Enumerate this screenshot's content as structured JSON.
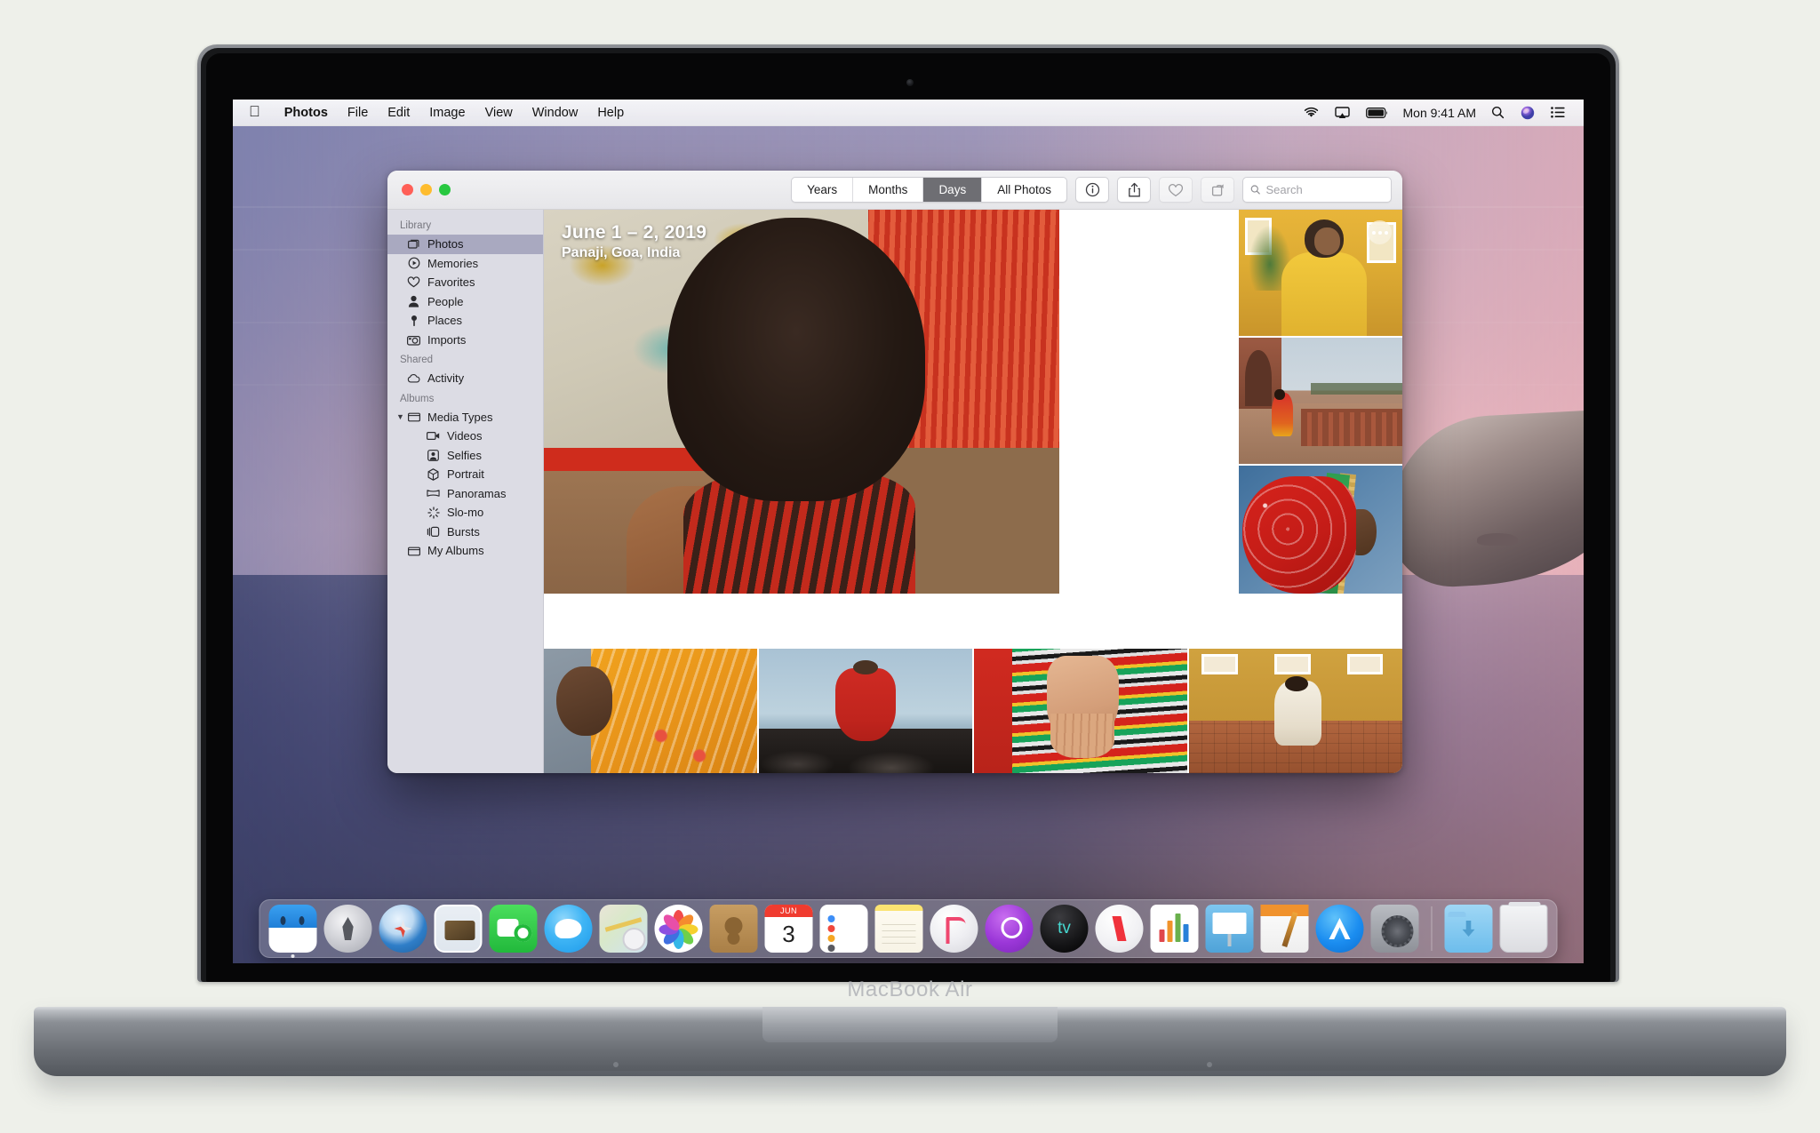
{
  "device": {
    "model_label": "MacBook Air"
  },
  "menubar": {
    "apple_glyph": "",
    "app_name": "Photos",
    "items": [
      "File",
      "Edit",
      "Image",
      "View",
      "Window",
      "Help"
    ],
    "status": {
      "wifi_icon": "wifi-icon",
      "airplay_icon": "airplay-icon",
      "battery_icon": "battery-icon",
      "clock": "Mon 9:41 AM",
      "spotlight_icon": "search-icon",
      "siri_icon": "siri-icon",
      "control_center_icon": "control-center-icon"
    }
  },
  "window": {
    "traffic_lights": {
      "close": "close",
      "minimize": "minimize",
      "zoom": "zoom"
    },
    "toolbar": {
      "segments": [
        {
          "label": "Years",
          "active": false
        },
        {
          "label": "Months",
          "active": false
        },
        {
          "label": "Days",
          "active": true
        },
        {
          "label": "All Photos",
          "active": false
        }
      ],
      "buttons": [
        {
          "name": "info-button",
          "icon": "info-icon",
          "enabled": true
        },
        {
          "name": "share-button",
          "icon": "share-icon",
          "enabled": true
        },
        {
          "name": "favorite-button",
          "icon": "heart-icon",
          "enabled": false
        },
        {
          "name": "rotate-button",
          "icon": "rotate-icon",
          "enabled": false
        }
      ],
      "search": {
        "placeholder": "Search",
        "value": "",
        "icon": "search-icon"
      }
    },
    "sidebar": {
      "sections": [
        {
          "title": "Library",
          "items": [
            {
              "label": "Photos",
              "icon": "photos-icon",
              "selected": true,
              "level": 0
            },
            {
              "label": "Memories",
              "icon": "memories-icon",
              "selected": false,
              "level": 0
            },
            {
              "label": "Favorites",
              "icon": "heart-icon",
              "selected": false,
              "level": 0
            },
            {
              "label": "People",
              "icon": "person-icon",
              "selected": false,
              "level": 0
            },
            {
              "label": "Places",
              "icon": "pin-icon",
              "selected": false,
              "level": 0
            },
            {
              "label": "Imports",
              "icon": "camera-icon",
              "selected": false,
              "level": 0
            }
          ]
        },
        {
          "title": "Shared",
          "items": [
            {
              "label": "Activity",
              "icon": "cloud-icon",
              "selected": false,
              "level": 0
            }
          ]
        },
        {
          "title": "Albums",
          "items": [
            {
              "label": "Media Types",
              "icon": "folder-icon",
              "selected": false,
              "level": 0,
              "expanded": true,
              "disclosure": "▼"
            },
            {
              "label": "Videos",
              "icon": "video-icon",
              "selected": false,
              "level": 1
            },
            {
              "label": "Selfies",
              "icon": "selfie-icon",
              "selected": false,
              "level": 1
            },
            {
              "label": "Portrait",
              "icon": "cube-icon",
              "selected": false,
              "level": 1
            },
            {
              "label": "Panoramas",
              "icon": "panorama-icon",
              "selected": false,
              "level": 1
            },
            {
              "label": "Slo-mo",
              "icon": "slomo-icon",
              "selected": false,
              "level": 1
            },
            {
              "label": "Bursts",
              "icon": "bursts-icon",
              "selected": false,
              "level": 1
            },
            {
              "label": "My Albums",
              "icon": "folder-icon",
              "selected": false,
              "level": 0
            }
          ]
        }
      ]
    },
    "grid": {
      "hero": {
        "date_range": "June 1 – 2, 2019",
        "location": "Panaji, Goa, India",
        "alt": "portrait of a woman with curly hair against a red shutter"
      },
      "more_button": {
        "name": "more-options-button",
        "icon": "ellipsis-icon"
      },
      "right_column": [
        {
          "alt": "man in yellow kurta by a yellow building"
        },
        {
          "alt": "woman in red sari walking at a monument"
        },
        {
          "alt": "woman in red bandhani veil against a blue wall"
        }
      ],
      "bottom_row": [
        {
          "alt": "woman in orange floral sari"
        },
        {
          "alt": "child in red dress on coastal rocks"
        },
        {
          "alt": "hand resting on striped cloth"
        },
        {
          "alt": "woman in white sari by an ochre wall"
        }
      ]
    }
  },
  "dock": {
    "items": [
      {
        "label": "Finder",
        "class": "i-finder",
        "running": true
      },
      {
        "label": "Launchpad",
        "class": "i-launchpad",
        "running": false
      },
      {
        "label": "Safari",
        "class": "i-safari",
        "running": false
      },
      {
        "label": "Mail",
        "class": "i-mail",
        "running": false
      },
      {
        "label": "FaceTime",
        "class": "i-facetime",
        "running": false
      },
      {
        "label": "Messages",
        "class": "i-messages",
        "running": false
      },
      {
        "label": "Maps",
        "class": "i-maps",
        "running": false
      },
      {
        "label": "Photos",
        "class": "i-photos",
        "running": true
      },
      {
        "label": "Contacts",
        "class": "i-contacts",
        "running": false
      },
      {
        "label": "Calendar",
        "class": "i-calendar",
        "running": false,
        "cal_month": "JUN",
        "cal_day": "3"
      },
      {
        "label": "Reminders",
        "class": "i-reminders",
        "running": false
      },
      {
        "label": "Notes",
        "class": "i-notes",
        "running": false
      },
      {
        "label": "iTunes",
        "class": "i-itunes",
        "running": false
      },
      {
        "label": "Podcasts",
        "class": "i-podcasts",
        "running": false
      },
      {
        "label": "Apple TV",
        "class": "i-appletv",
        "running": false,
        "glyph": "tv"
      },
      {
        "label": "News",
        "class": "i-news",
        "running": false
      },
      {
        "label": "Numbers",
        "class": "i-numbers",
        "running": false
      },
      {
        "label": "Keynote",
        "class": "i-keynote",
        "running": false
      },
      {
        "label": "Pages",
        "class": "i-pages",
        "running": false
      },
      {
        "label": "App Store",
        "class": "i-appstore",
        "running": false
      },
      {
        "label": "System Preferences",
        "class": "i-syspref",
        "running": false
      }
    ],
    "trailing": [
      {
        "label": "Downloads",
        "class": "i-downloads"
      },
      {
        "label": "Trash",
        "class": "i-trash"
      }
    ]
  },
  "colors": {
    "selection": "#a9a9c0",
    "segment_active_bg": "#6e6e73",
    "traffic_red": "#ff5f57",
    "traffic_yellow": "#febc2e",
    "traffic_green": "#28c840",
    "sidebar_bg": "#dcdce4",
    "desktop_backdrop": "#eef0ea"
  }
}
